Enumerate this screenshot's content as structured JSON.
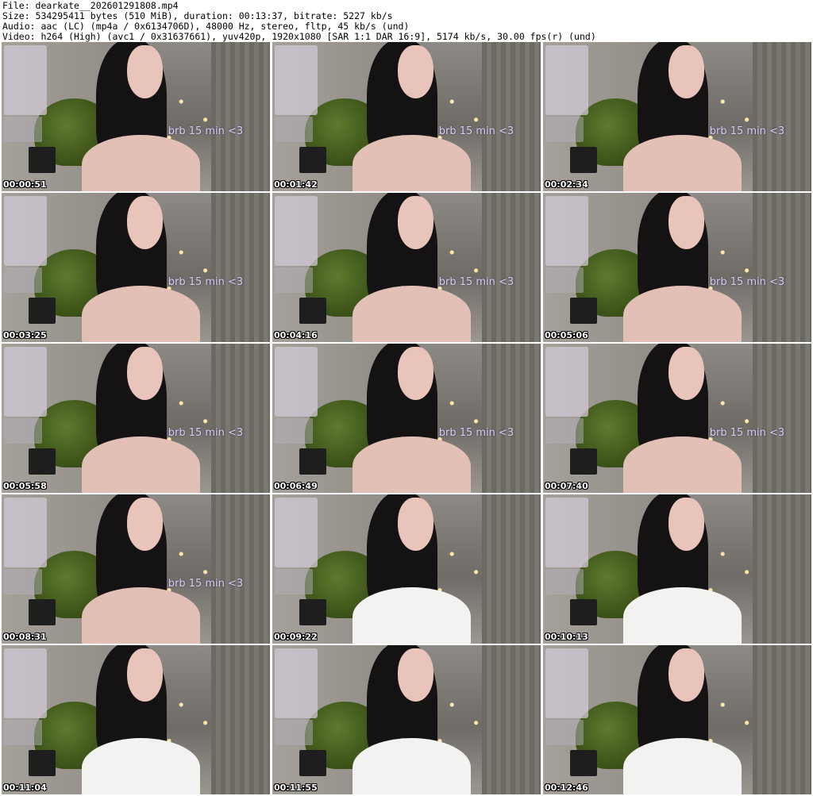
{
  "header": {
    "line1": "File: dearkate__202601291808.mp4",
    "line2": "Size: 534295411 bytes (510 MiB), duration: 00:13:37, bitrate: 5227 kb/s",
    "line3": "Audio: aac (LC) (mp4a / 0x6134706D), 48000 Hz, stereo, fltp, 45 kb/s (und)",
    "line4": "Video: h264 (High) (avc1 / 0x31637661), yuv420p, 1920x1080 [SAR 1:1 DAR 16:9], 5174 kb/s, 30.00 fps(r) (und)"
  },
  "thumbnails": [
    {
      "timestamp": "00:00:51",
      "caption": "brb 15 min <3"
    },
    {
      "timestamp": "00:01:42",
      "caption": "brb 15 min <3"
    },
    {
      "timestamp": "00:02:34",
      "caption": "brb 15 min <3"
    },
    {
      "timestamp": "00:03:25",
      "caption": "brb 15 min <3"
    },
    {
      "timestamp": "00:04:16",
      "caption": "brb 15 min <3"
    },
    {
      "timestamp": "00:05:06",
      "caption": "brb 15 min <3"
    },
    {
      "timestamp": "00:05:58",
      "caption": "brb 15 min <3"
    },
    {
      "timestamp": "00:06:49",
      "caption": "brb 15 min <3"
    },
    {
      "timestamp": "00:07:40",
      "caption": "brb 15 min <3"
    },
    {
      "timestamp": "00:08:31",
      "caption": "brb 15 min <3"
    },
    {
      "timestamp": "00:09:22",
      "caption": ""
    },
    {
      "timestamp": "00:10:13",
      "caption": ""
    },
    {
      "timestamp": "00:11:04",
      "caption": ""
    },
    {
      "timestamp": "00:11:55",
      "caption": ""
    },
    {
      "timestamp": "00:12:46",
      "caption": ""
    }
  ]
}
